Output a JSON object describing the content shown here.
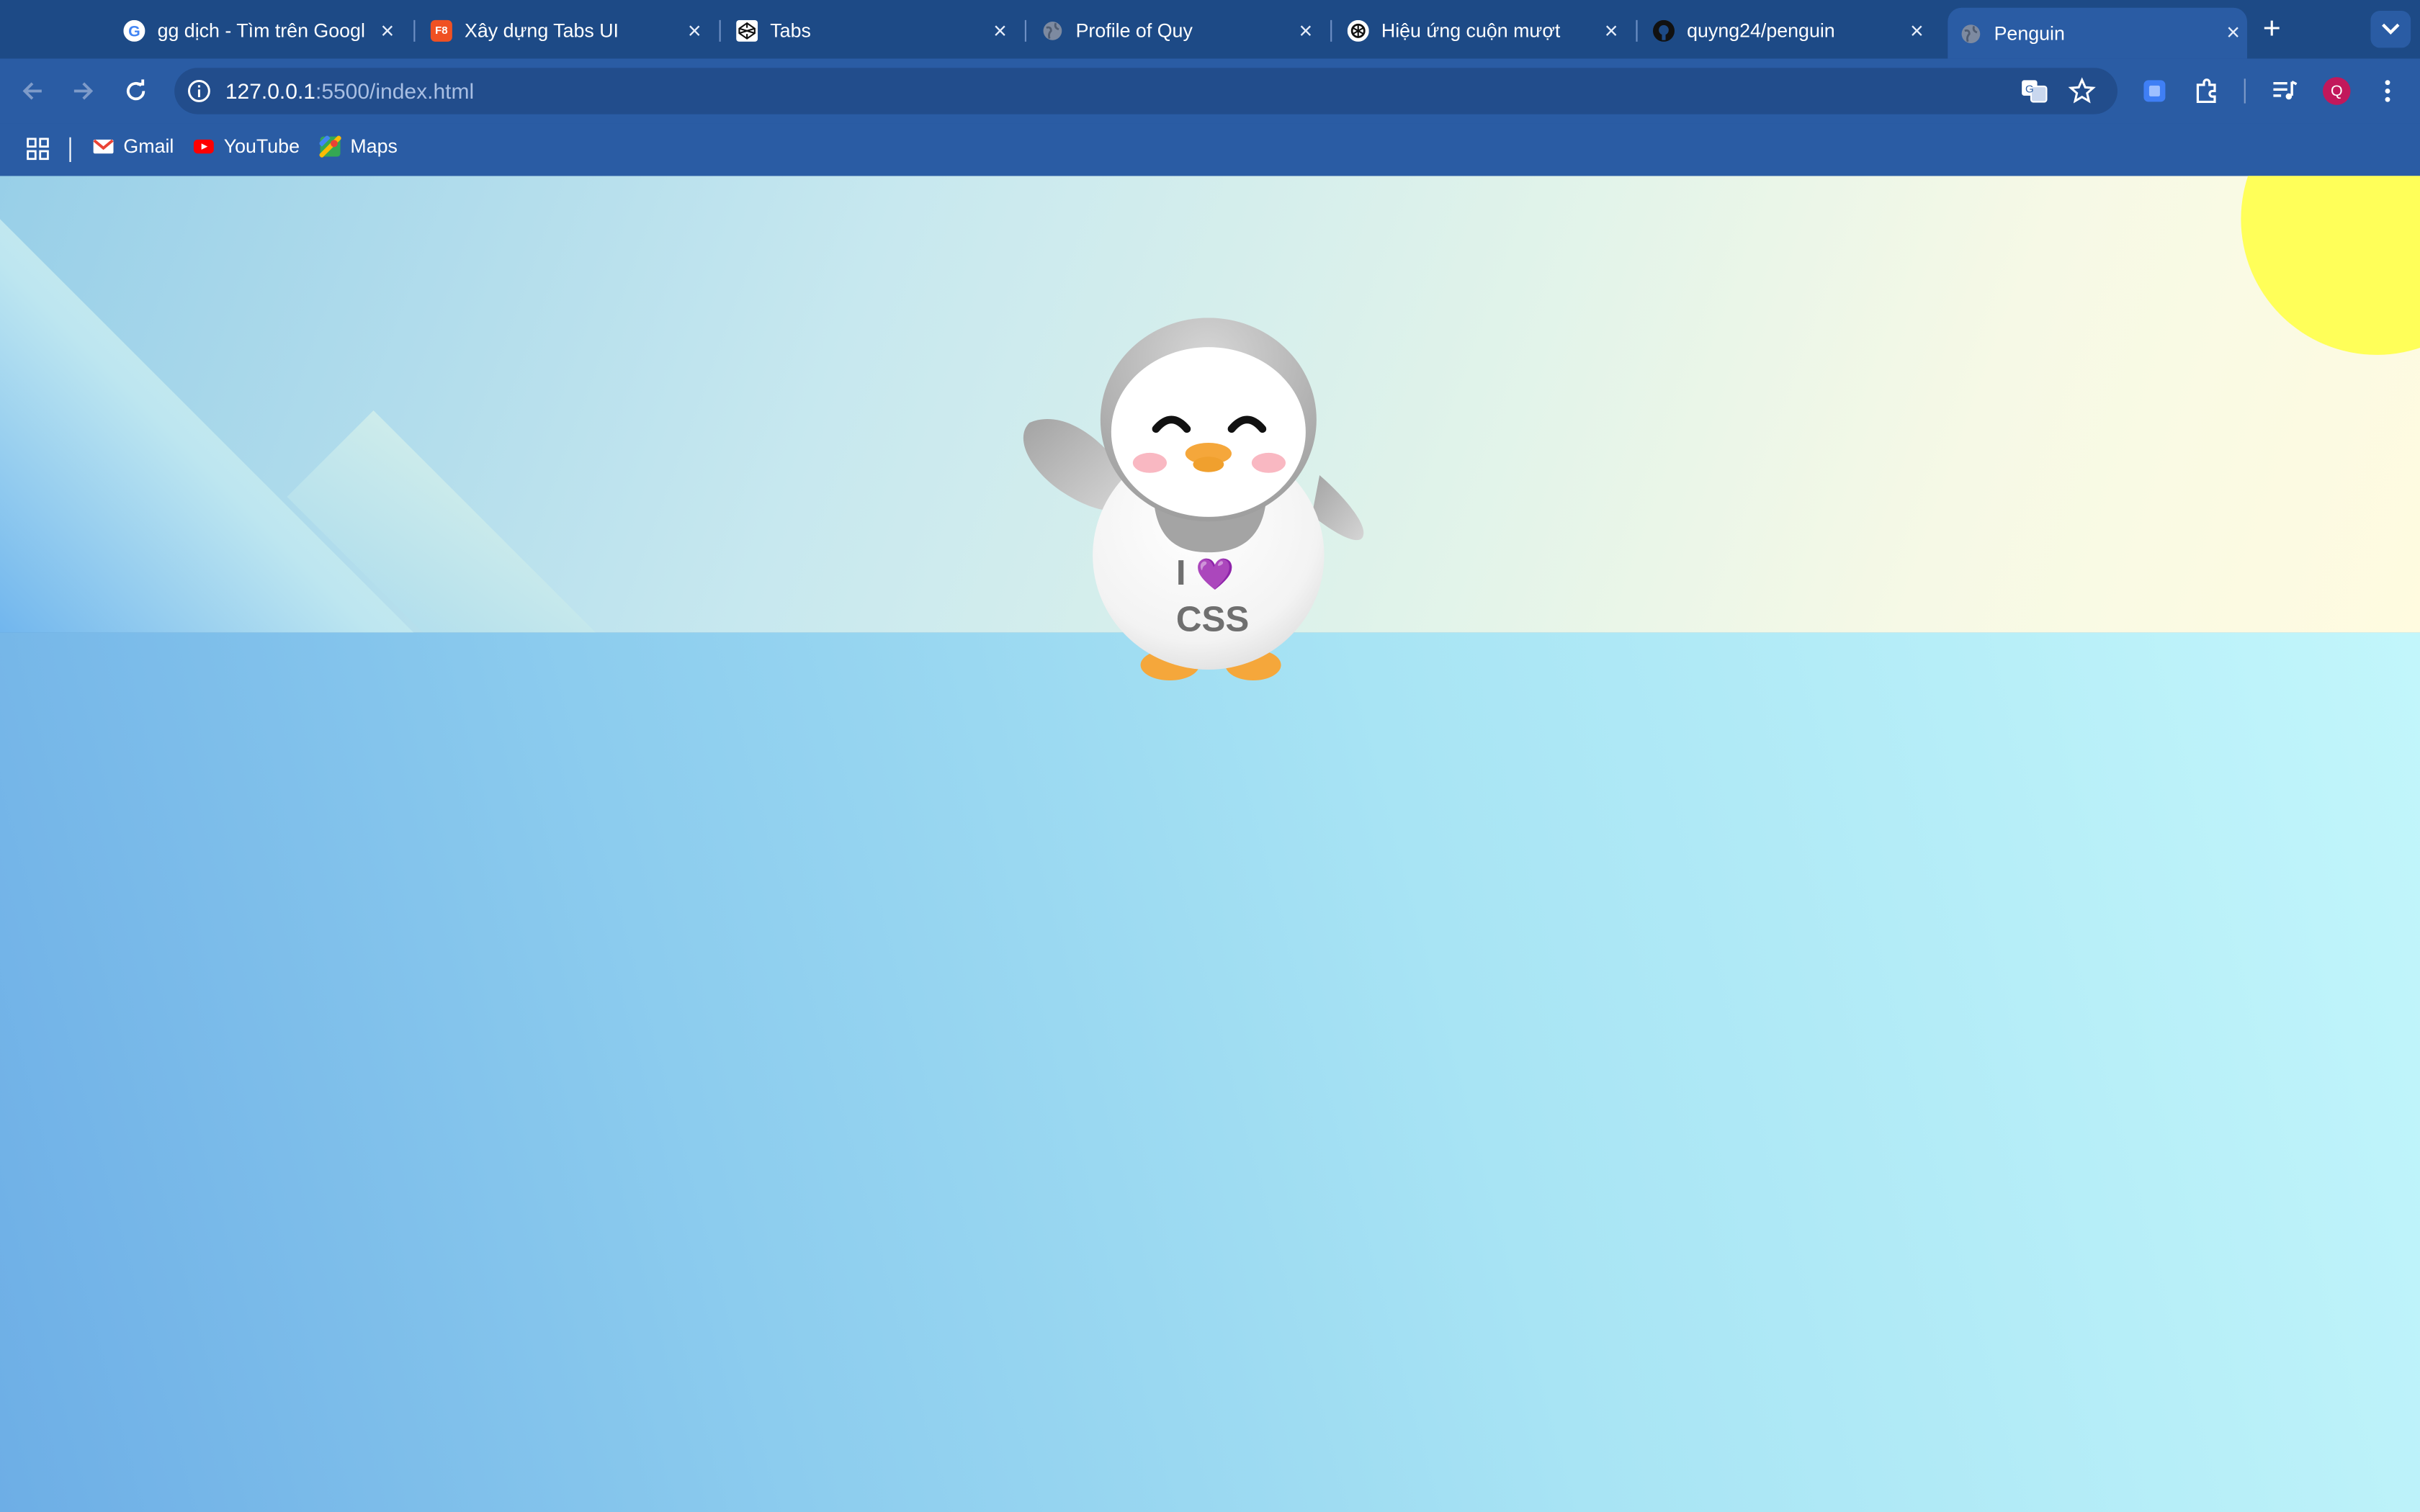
{
  "tabs": [
    {
      "title": "gg dịch - Tìm trên Google",
      "favicon": "google-icon",
      "active": false
    },
    {
      "title": "Xây dựng Tabs UI",
      "favicon": "f8-icon",
      "favicon_text": "F8",
      "active": false
    },
    {
      "title": "Tabs",
      "favicon": "codepen-icon",
      "active": false
    },
    {
      "title": "Profile of Quy",
      "favicon": "globe-icon",
      "active": false
    },
    {
      "title": "Hiệu ứng cuộn mượt",
      "favicon": "openai-icon",
      "active": false
    },
    {
      "title": "quyng24/penguin",
      "favicon": "github-icon",
      "active": false
    },
    {
      "title": "Penguin",
      "favicon": "globe-icon",
      "active": true
    }
  ],
  "address_bar": {
    "url_host": "127.0.0.1",
    "url_path": ":5500/index.html"
  },
  "profile": {
    "initial": "Q",
    "color": "#c2185b"
  },
  "bookmarks": [
    {
      "label": "Gmail",
      "icon": "gmail-icon"
    },
    {
      "label": "YouTube",
      "icon": "youtube-icon"
    },
    {
      "label": "Maps",
      "icon": "maps-icon"
    }
  ],
  "penguin": {
    "shirt_line1": "I",
    "shirt_heart": "💜",
    "shirt_line2": "CSS"
  },
  "colors": {
    "sun": "#ffff59",
    "beak": "#f5a73b",
    "cheeks": "#f9b8c2",
    "tab_strip": "#1d4a86",
    "toolbar": "#2a5ca4"
  }
}
